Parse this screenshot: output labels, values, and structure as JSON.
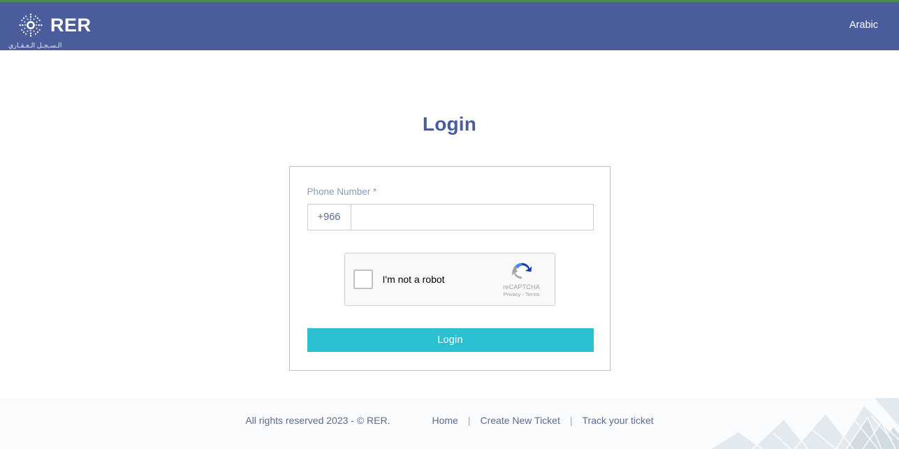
{
  "header": {
    "brand_title": "RER",
    "brand_subtitle": "الـسـجـل الـعـقـاري",
    "brand_mark_icon": "dotted-mandala-logo-icon",
    "language_toggle": "Arabic",
    "background_color": "#4a5c9b",
    "accent_line_color": "#4d8a4e"
  },
  "main": {
    "page_title": "Login",
    "form": {
      "phone_label": "Phone Number *",
      "phone_prefix": "+966",
      "phone_value": "",
      "phone_placeholder": "",
      "submit_label": "Login",
      "submit_color": "#2bc0cf"
    },
    "recaptcha": {
      "checkbox_label": "I'm not a robot",
      "brand_name": "reCAPTCHA",
      "privacy_label": "Privacy",
      "separator": "-",
      "terms_label": "Terms",
      "logo_icon": "recaptcha-circular-arrows-icon",
      "checked": false
    }
  },
  "footer": {
    "copyright": "All rights reserved 2023 - © RER.",
    "links": [
      {
        "label": "Home"
      },
      {
        "label": "Create New Ticket"
      },
      {
        "label": "Track your ticket"
      }
    ],
    "separator": "|",
    "background_color": "#fafbfd",
    "decoration_icon": "geometric-pattern-decoration"
  }
}
